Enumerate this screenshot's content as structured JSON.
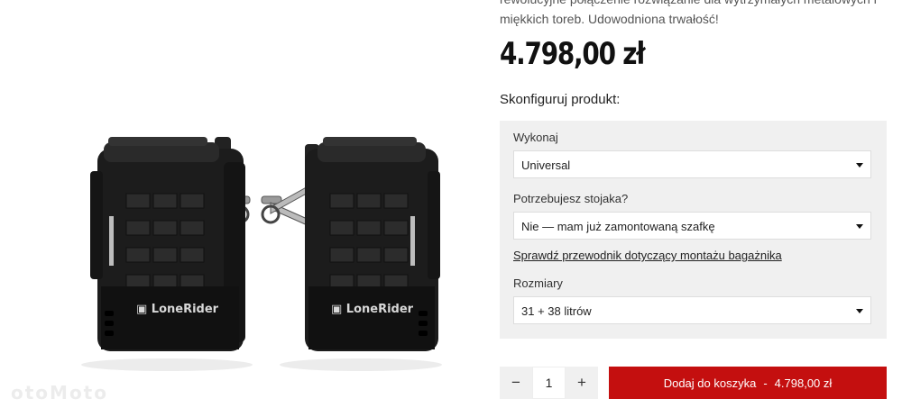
{
  "product": {
    "description": "rewolucyjne połączenie rozwiązanie dla wytrzymałych metalowych i miękkich toreb. Udowodniona trwałość!",
    "price": "4.798,00 zł",
    "brand_on_bags": "LoneRider",
    "watermark": "otoMoto"
  },
  "config": {
    "heading": "Skonfiguruj produkt:",
    "wykonaj": {
      "label": "Wykonaj",
      "value": "Universal"
    },
    "stojak": {
      "label": "Potrzebujesz stojaka?",
      "value": "Nie — mam już zamontowaną szafkę"
    },
    "guide_link": "Sprawdź przewodnik dotyczący montażu bagażnika",
    "rozmiary": {
      "label": "Rozmiary",
      "value": "31 + 38 litrów"
    }
  },
  "cart": {
    "minus": "−",
    "quantity": "1",
    "plus": "+",
    "add_label": "Dodaj do koszyka",
    "separator": "-",
    "add_price": "4.798,00 zł"
  },
  "colors": {
    "accent": "#c40f0f",
    "panel": "#f0f0f0"
  }
}
